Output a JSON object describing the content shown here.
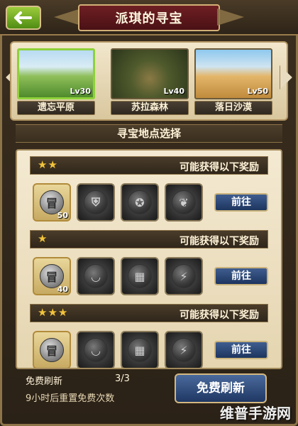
{
  "header": {
    "back_icon": "back-arrow-icon",
    "title": "派琪的寻宝"
  },
  "maps": [
    {
      "name": "遗忘平原",
      "level": "Lv30",
      "selected": true
    },
    {
      "name": "苏拉森林",
      "level": "Lv40",
      "selected": false
    },
    {
      "name": "落日沙漠",
      "level": "Lv50",
      "selected": false
    }
  ],
  "section": {
    "title": "寻宝地点选择"
  },
  "rows": [
    {
      "stars": "★★",
      "reward_label": "可能获得以下奖励",
      "coin": {
        "glyph": "冒",
        "count": "50"
      },
      "rewards": [
        {
          "icon": "shield-icon",
          "glyph": "⛨"
        },
        {
          "icon": "star-emblem-icon",
          "glyph": "✪"
        },
        {
          "icon": "leaf-icon",
          "glyph": "❦"
        }
      ],
      "button": "前往"
    },
    {
      "stars": "★",
      "reward_label": "可能获得以下奖励",
      "coin": {
        "glyph": "冒",
        "count": "40"
      },
      "rewards": [
        {
          "icon": "bowl-icon",
          "glyph": "◡"
        },
        {
          "icon": "wall-icon",
          "glyph": "▦"
        },
        {
          "icon": "claw-icon",
          "glyph": "⚡"
        }
      ],
      "button": "前往"
    },
    {
      "stars": "★★★",
      "reward_label": "可能获得以下奖励",
      "coin": {
        "glyph": "冒",
        "count": ""
      },
      "rewards": [
        {
          "icon": "bowl-icon",
          "glyph": "◡"
        },
        {
          "icon": "wall-icon",
          "glyph": "▦"
        },
        {
          "icon": "claw-icon",
          "glyph": "⚡"
        }
      ],
      "button": "前往"
    }
  ],
  "footer": {
    "free_refresh_label": "免费刷新",
    "free_refresh_count": "3/3",
    "reset_hint": "9小时后重置免费次数",
    "refresh_button": "免费刷新"
  },
  "watermark": "维普手游网",
  "colors": {
    "accent_green": "#8fd13a",
    "button_blue": "#1d355f",
    "star_gold": "#f2c33a",
    "title_red": "#6e1f23"
  }
}
